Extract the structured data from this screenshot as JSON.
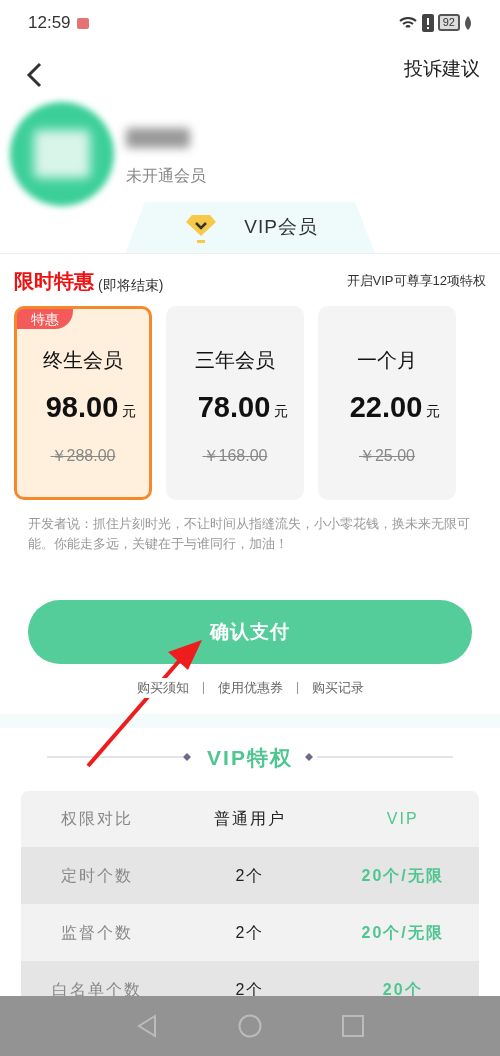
{
  "status_bar": {
    "time": "12:59",
    "battery": "92"
  },
  "header": {
    "action": "投诉建议"
  },
  "profile": {
    "status": "未开通会员"
  },
  "vip_tab": {
    "label": "VIP会员"
  },
  "offer": {
    "title": "限时特惠",
    "note": "(即将结束)",
    "benefits": "开启VIP可尊享12项特权"
  },
  "plans": [
    {
      "badge": "特惠",
      "name": "终生会员",
      "price": "98.00",
      "unit": "元",
      "original": "￥288.00",
      "selected": true
    },
    {
      "name": "三年会员",
      "price": "78.00",
      "unit": "元",
      "original": "￥168.00",
      "selected": false
    },
    {
      "name": "一个月",
      "price": "22.00",
      "unit": "元",
      "original": "￥25.00",
      "selected": false
    }
  ],
  "developer_note": "开发者说：抓住片刻时光，不让时间从指缝流失，小小零花钱，换未来无限可能。你能走多远，关键在于与谁同行，加油！",
  "pay_button": "确认支付",
  "links": [
    "购买须知",
    "使用优惠券",
    "购买记录"
  ],
  "privileges": {
    "title": "VIP特权",
    "columns": [
      "权限对比",
      "普通用户",
      "VIP"
    ],
    "rows": [
      [
        "定时个数",
        "2个",
        "20个/无限"
      ],
      [
        "监督个数",
        "2个",
        "20个/无限"
      ],
      [
        "白名单个数",
        "2个",
        "20个"
      ]
    ]
  }
}
